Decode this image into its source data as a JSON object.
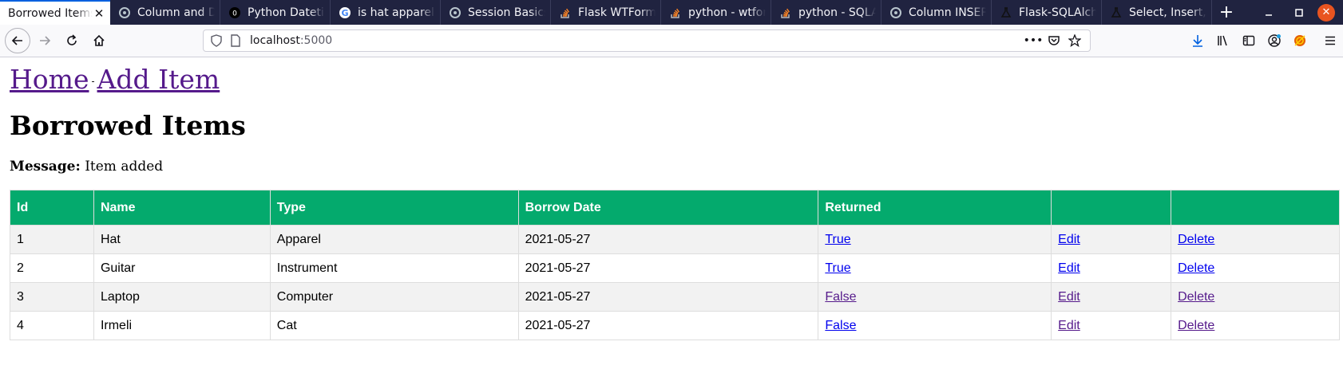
{
  "browser": {
    "tabs": [
      {
        "title": "Borrowed Items",
        "icon": "page-icon",
        "active": true
      },
      {
        "title": "Column and Data Types",
        "icon": "sqlalchemy-icon",
        "active": false
      },
      {
        "title": "Python Datetime",
        "icon": "w3-icon",
        "active": false
      },
      {
        "title": "is hat apparel - Google",
        "icon": "google-icon",
        "active": false
      },
      {
        "title": "Session Basics",
        "icon": "sqlalchemy-icon",
        "active": false
      },
      {
        "title": "Flask WTForms",
        "icon": "stackoverflow-icon",
        "active": false
      },
      {
        "title": "python - wtforms",
        "icon": "stackoverflow-icon",
        "active": false
      },
      {
        "title": "python - SQLAlchemy",
        "icon": "stackoverflow-icon",
        "active": false
      },
      {
        "title": "Column INSERT/UPDATE",
        "icon": "sqlalchemy-icon",
        "active": false
      },
      {
        "title": "Flask-SQLAlchemy",
        "icon": "flask-icon",
        "active": false
      },
      {
        "title": "Select, Insert, Delete",
        "icon": "flask-icon",
        "active": false
      }
    ],
    "url_host": "localhost",
    "url_port": ":5000"
  },
  "nav": {
    "home": "Home",
    "separator": "-",
    "add_item": "Add Item"
  },
  "heading": "Borrowed Items",
  "message": {
    "label": "Message:",
    "text": "Item added"
  },
  "table": {
    "headers": [
      "Id",
      "Name",
      "Type",
      "Borrow Date",
      "Returned",
      "",
      ""
    ],
    "rows": [
      {
        "id": "1",
        "name": "Hat",
        "type": "Apparel",
        "date": "2021-05-27",
        "returned": "True",
        "edit": "Edit",
        "delete": "Delete"
      },
      {
        "id": "2",
        "name": "Guitar",
        "type": "Instrument",
        "date": "2021-05-27",
        "returned": "True",
        "edit": "Edit",
        "delete": "Delete"
      },
      {
        "id": "3",
        "name": "Laptop",
        "type": "Computer",
        "date": "2021-05-27",
        "returned": "False",
        "edit": "Edit",
        "delete": "Delete"
      },
      {
        "id": "4",
        "name": "Irmeli",
        "type": "Cat",
        "date": "2021-05-27",
        "returned": "False",
        "edit": "Edit",
        "delete": "Delete"
      }
    ]
  },
  "colors": {
    "header_green": "#04aa6d",
    "link_unvisited": "#0000ee",
    "link_visited": "#551a8b",
    "tabbar_bg": "#202340"
  }
}
